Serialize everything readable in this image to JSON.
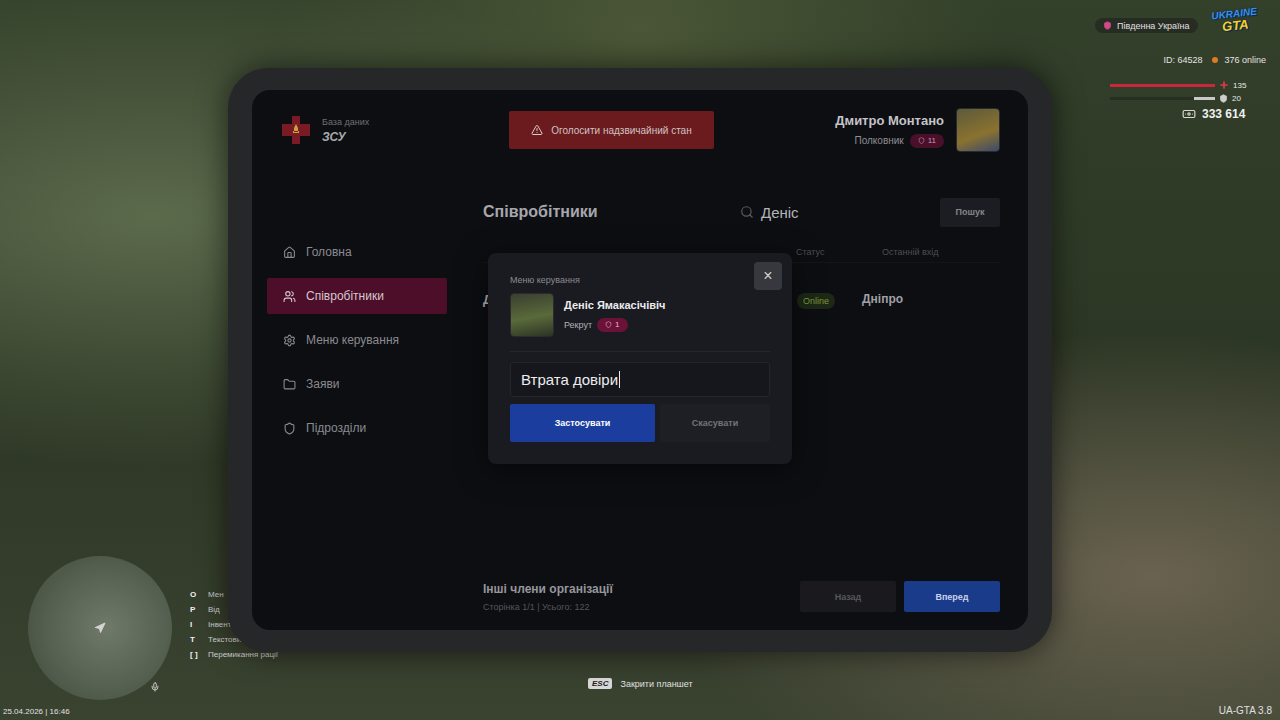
{
  "hud": {
    "region": "Південна Україна",
    "logo": [
      "UKRAINE",
      "GTA"
    ],
    "player_id": "ID: 64528",
    "online": "376 online",
    "health": {
      "value": "135",
      "level": 1
    },
    "armor": {
      "value": "20",
      "level": 0.2
    },
    "money": "333 614",
    "datetime": "25.04.2026 | 16:46",
    "version": "UA-GTA 3.8",
    "hint": {
      "key": "ESC",
      "label": "Закрити планшет"
    },
    "hotkeys": [
      {
        "key": "O",
        "label": "Мен"
      },
      {
        "key": "P",
        "label": "Від"
      },
      {
        "key": "I",
        "label": "Інвент"
      },
      {
        "key": "T",
        "label": "Текстовий чат"
      },
      {
        "key": "[ ]",
        "label": "Перемикання рації"
      }
    ]
  },
  "tablet": {
    "brand": {
      "subtitle": "База даних",
      "title": "ЗСУ"
    },
    "emergency_button": "Оголосити надзвичайний стан",
    "user": {
      "name": "Дмитро Монтано",
      "rank": "Полковник",
      "level": "11"
    },
    "sidebar": {
      "items": [
        {
          "label": "Головна",
          "selected": false
        },
        {
          "label": "Співробітники",
          "selected": true
        },
        {
          "label": "Меню керування",
          "selected": false
        },
        {
          "label": "Заяви",
          "selected": false
        },
        {
          "label": "Підрозділи",
          "selected": false
        }
      ]
    },
    "page_title": "Співробітники",
    "search": {
      "value": "Деніс",
      "button": "Пошук"
    },
    "table": {
      "columns": [
        "Статус",
        "Останній вхід"
      ],
      "rows": [
        {
          "name": "Д",
          "status": "Online",
          "location": "Дніпро"
        }
      ]
    },
    "footer": {
      "title": "Інші члени організації",
      "info": "Сторінка 1/1 | Усього: 122",
      "buttons": [
        {
          "label": "Назад",
          "primary": false
        },
        {
          "label": "Вперед",
          "primary": true
        }
      ]
    }
  },
  "modal": {
    "title": "Меню керування",
    "close": "×",
    "member": {
      "name": "Деніс Ямакасічівіч",
      "rank": "Рекрут",
      "level": "1"
    },
    "input": {
      "value": "Втрата довіри",
      "focused": true
    },
    "buttons": [
      {
        "label": "Застосувати",
        "primary": true
      },
      {
        "label": "Скасувати",
        "primary": false
      }
    ]
  }
}
